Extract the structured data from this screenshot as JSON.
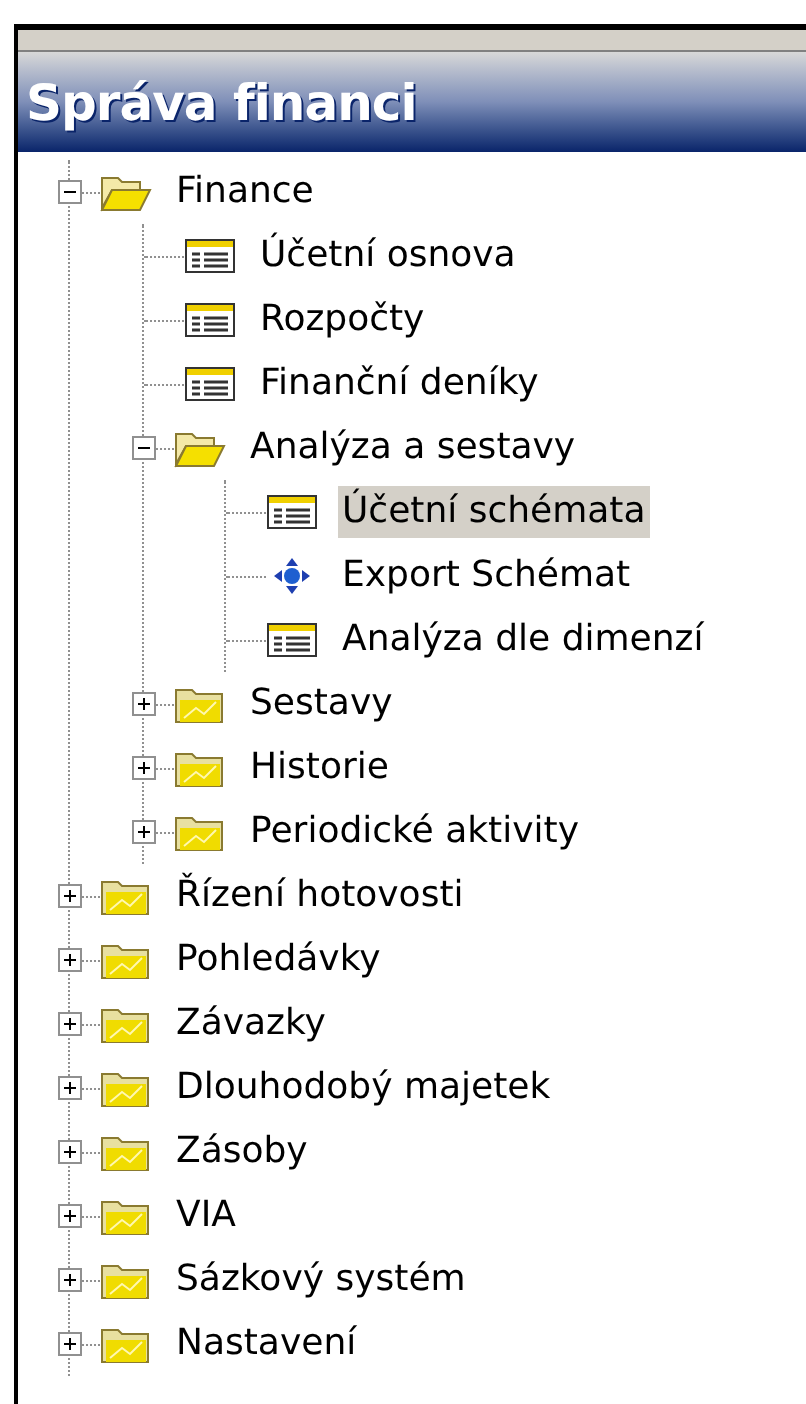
{
  "panel": {
    "title": "Správa financi"
  },
  "tree": [
    {
      "label": "Finance",
      "kind": "folder",
      "expanded": true,
      "selected": false,
      "children": [
        {
          "label": "Účetní osnova",
          "kind": "form",
          "selected": false
        },
        {
          "label": "Rozpočty",
          "kind": "form",
          "selected": false
        },
        {
          "label": "Finanční deníky",
          "kind": "form",
          "selected": false
        },
        {
          "label": "Analýza a sestavy",
          "kind": "folder",
          "expanded": true,
          "selected": false,
          "children": [
            {
              "label": "Účetní schémata",
              "kind": "form",
              "selected": true
            },
            {
              "label": "Export Schémat",
              "kind": "action",
              "selected": false
            },
            {
              "label": "Analýza dle dimenzí",
              "kind": "form",
              "selected": false
            }
          ]
        },
        {
          "label": "Sestavy",
          "kind": "folder",
          "expanded": false,
          "selected": false
        },
        {
          "label": "Historie",
          "kind": "folder",
          "expanded": false,
          "selected": false
        },
        {
          "label": "Periodické aktivity",
          "kind": "folder",
          "expanded": false,
          "selected": false
        }
      ]
    },
    {
      "label": "Řízení hotovosti",
      "kind": "folder",
      "expanded": false,
      "selected": false
    },
    {
      "label": "Pohledávky",
      "kind": "folder",
      "expanded": false,
      "selected": false
    },
    {
      "label": "Závazky",
      "kind": "folder",
      "expanded": false,
      "selected": false
    },
    {
      "label": "Dlouhodobý majetek",
      "kind": "folder",
      "expanded": false,
      "selected": false
    },
    {
      "label": "Zásoby",
      "kind": "folder",
      "expanded": false,
      "selected": false
    },
    {
      "label": "VIA",
      "kind": "folder",
      "expanded": false,
      "selected": false
    },
    {
      "label": "Sázkový systém",
      "kind": "folder",
      "expanded": false,
      "selected": false
    },
    {
      "label": "Nastavení",
      "kind": "folder",
      "expanded": false,
      "selected": false
    }
  ]
}
